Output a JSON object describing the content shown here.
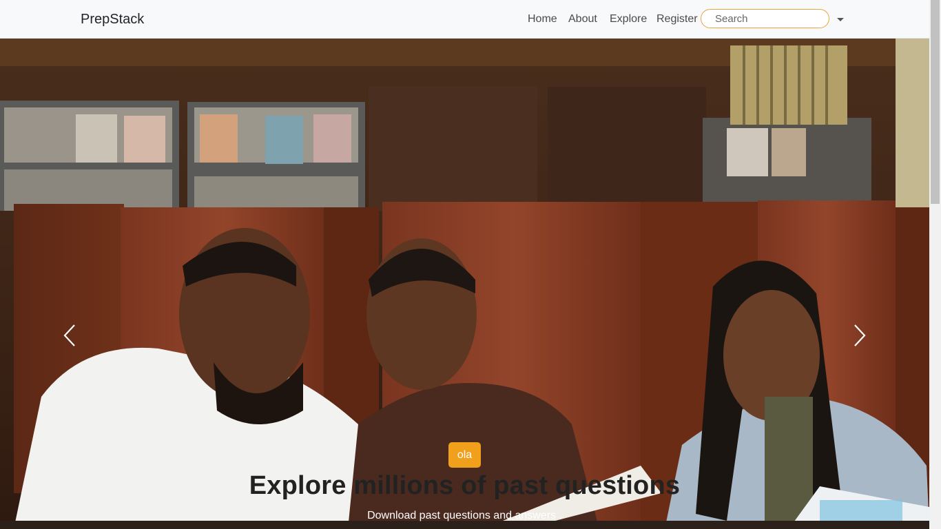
{
  "navbar": {
    "brand": "PrepStack",
    "links": [
      "Home",
      "About",
      "Explore",
      "Register"
    ],
    "search_placeholder": "Search"
  },
  "hero": {
    "badge": "ola",
    "headline": "Explore millions of past questions",
    "subtext": "Download past questions and answers ."
  },
  "colors": {
    "accent": "#f0a01a",
    "navbar_bg": "#f8f9fa",
    "search_border": "#e8a43c"
  },
  "icons": {
    "prev": "chevron-left-icon",
    "next": "chevron-right-icon",
    "dropdown": "caret-down-icon"
  }
}
